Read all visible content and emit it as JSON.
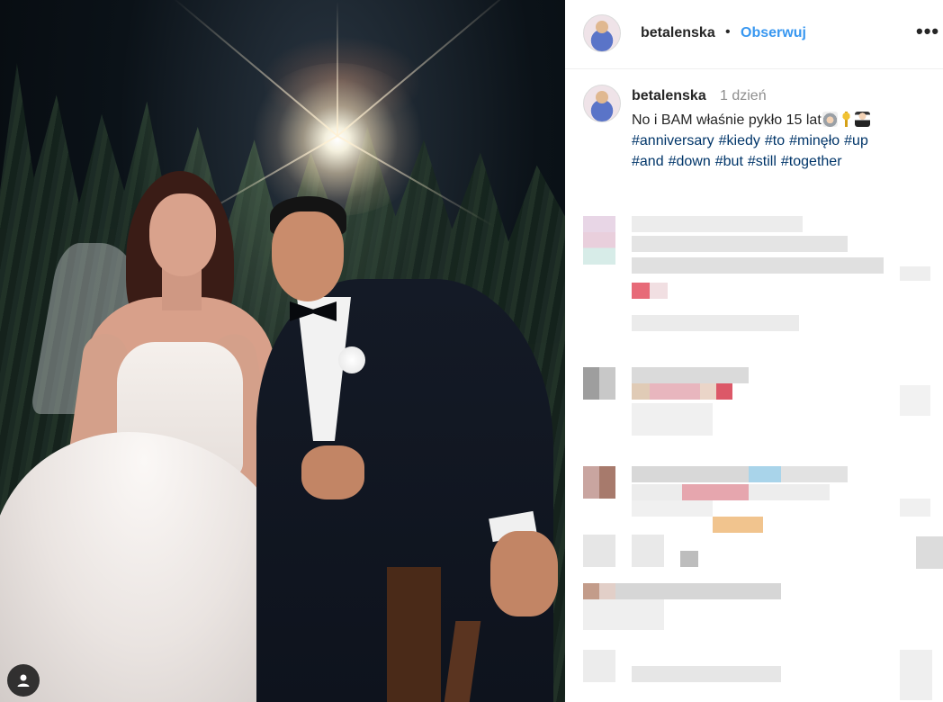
{
  "post": {
    "username": "betalenska",
    "follow_label": "Obserwuj",
    "separator": "•",
    "more_label": "•••"
  },
  "caption": {
    "username": "betalenska",
    "time": "1 dzień",
    "text": "No i BAM właśnie pykło 15 lat",
    "emojis": [
      "bride-emoji",
      "key-emoji",
      "groom-emoji"
    ],
    "hashtags": [
      "#anniversary",
      "#kiedy",
      "#to",
      "#minęło",
      "#up",
      "#and",
      "#down",
      "#but",
      "#still",
      "#together"
    ]
  },
  "photo": {
    "user_tag_icon": "user-tag-icon"
  },
  "colors": {
    "link_blue": "#3897f0",
    "hashtag_blue": "#003569",
    "text": "#262626",
    "muted": "#8e8e8e"
  }
}
